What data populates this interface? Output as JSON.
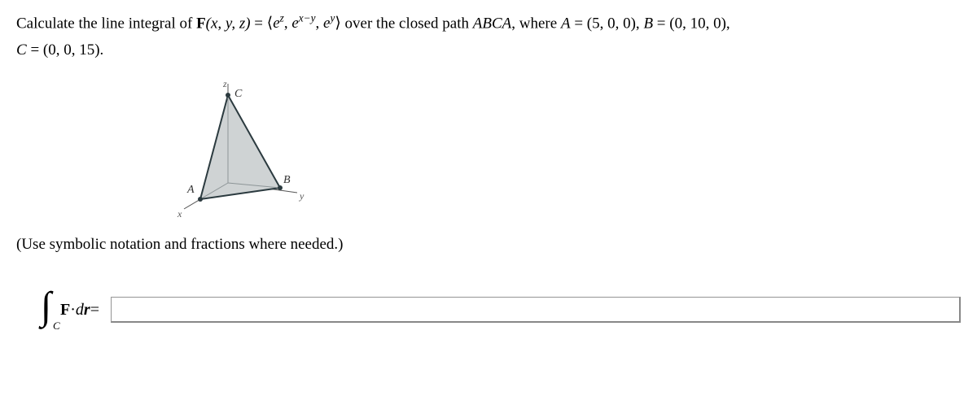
{
  "problem": {
    "line1_prefix": "Calculate the line integral of ",
    "F_label": "F",
    "F_args": "(x, y, z)",
    "eq": " = ",
    "vec_open": "⟨",
    "c1_base": "e",
    "c1_exp": "z",
    "sep": ", ",
    "c2_base": "e",
    "c2_exp": "x−y",
    "c3_base": "e",
    "c3_exp": "y",
    "vec_close": "⟩",
    "over_text": " over the closed path ",
    "path_name": "ABCA",
    "where_text": ", where ",
    "A_label": "A",
    "A_val": " = (5, 0, 0), ",
    "B_label": "B",
    "B_val": " = (0, 10, 0),",
    "C_label": "C",
    "C_val": " = (0, 0, 15)."
  },
  "diagram": {
    "axis_x": "x",
    "axis_y": "y",
    "axis_z": "z",
    "pt_A": "A",
    "pt_B": "B",
    "pt_C": "C"
  },
  "instruction": "(Use symbolic notation and fractions where needed.)",
  "answer": {
    "integral_sub": "C",
    "F": "F",
    "dot": " · ",
    "dr": "dr",
    "eq": " = ",
    "value": ""
  }
}
